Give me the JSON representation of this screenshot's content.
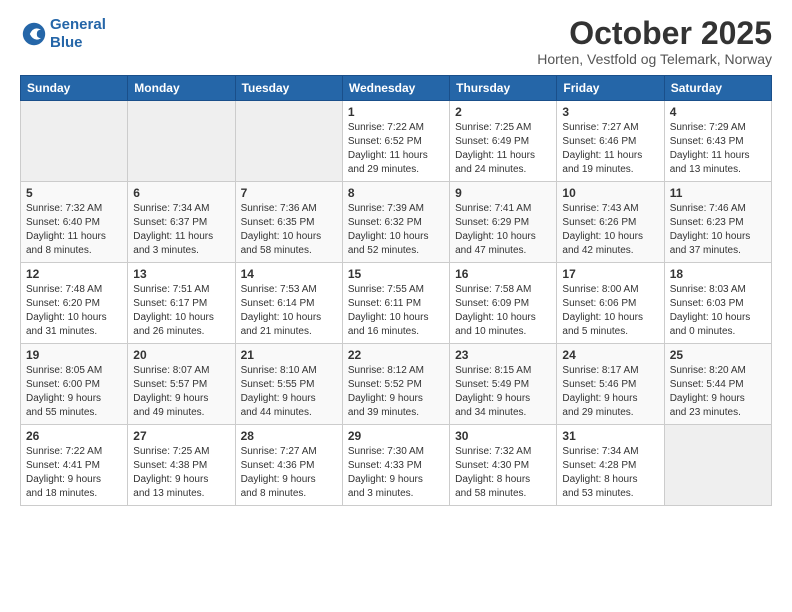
{
  "header": {
    "logo_line1": "General",
    "logo_line2": "Blue",
    "title": "October 2025",
    "subtitle": "Horten, Vestfold og Telemark, Norway"
  },
  "days_of_week": [
    "Sunday",
    "Monday",
    "Tuesday",
    "Wednesday",
    "Thursday",
    "Friday",
    "Saturday"
  ],
  "weeks": [
    [
      {
        "num": "",
        "info": ""
      },
      {
        "num": "",
        "info": ""
      },
      {
        "num": "",
        "info": ""
      },
      {
        "num": "1",
        "info": "Sunrise: 7:22 AM\nSunset: 6:52 PM\nDaylight: 11 hours\nand 29 minutes."
      },
      {
        "num": "2",
        "info": "Sunrise: 7:25 AM\nSunset: 6:49 PM\nDaylight: 11 hours\nand 24 minutes."
      },
      {
        "num": "3",
        "info": "Sunrise: 7:27 AM\nSunset: 6:46 PM\nDaylight: 11 hours\nand 19 minutes."
      },
      {
        "num": "4",
        "info": "Sunrise: 7:29 AM\nSunset: 6:43 PM\nDaylight: 11 hours\nand 13 minutes."
      }
    ],
    [
      {
        "num": "5",
        "info": "Sunrise: 7:32 AM\nSunset: 6:40 PM\nDaylight: 11 hours\nand 8 minutes."
      },
      {
        "num": "6",
        "info": "Sunrise: 7:34 AM\nSunset: 6:37 PM\nDaylight: 11 hours\nand 3 minutes."
      },
      {
        "num": "7",
        "info": "Sunrise: 7:36 AM\nSunset: 6:35 PM\nDaylight: 10 hours\nand 58 minutes."
      },
      {
        "num": "8",
        "info": "Sunrise: 7:39 AM\nSunset: 6:32 PM\nDaylight: 10 hours\nand 52 minutes."
      },
      {
        "num": "9",
        "info": "Sunrise: 7:41 AM\nSunset: 6:29 PM\nDaylight: 10 hours\nand 47 minutes."
      },
      {
        "num": "10",
        "info": "Sunrise: 7:43 AM\nSunset: 6:26 PM\nDaylight: 10 hours\nand 42 minutes."
      },
      {
        "num": "11",
        "info": "Sunrise: 7:46 AM\nSunset: 6:23 PM\nDaylight: 10 hours\nand 37 minutes."
      }
    ],
    [
      {
        "num": "12",
        "info": "Sunrise: 7:48 AM\nSunset: 6:20 PM\nDaylight: 10 hours\nand 31 minutes."
      },
      {
        "num": "13",
        "info": "Sunrise: 7:51 AM\nSunset: 6:17 PM\nDaylight: 10 hours\nand 26 minutes."
      },
      {
        "num": "14",
        "info": "Sunrise: 7:53 AM\nSunset: 6:14 PM\nDaylight: 10 hours\nand 21 minutes."
      },
      {
        "num": "15",
        "info": "Sunrise: 7:55 AM\nSunset: 6:11 PM\nDaylight: 10 hours\nand 16 minutes."
      },
      {
        "num": "16",
        "info": "Sunrise: 7:58 AM\nSunset: 6:09 PM\nDaylight: 10 hours\nand 10 minutes."
      },
      {
        "num": "17",
        "info": "Sunrise: 8:00 AM\nSunset: 6:06 PM\nDaylight: 10 hours\nand 5 minutes."
      },
      {
        "num": "18",
        "info": "Sunrise: 8:03 AM\nSunset: 6:03 PM\nDaylight: 10 hours\nand 0 minutes."
      }
    ],
    [
      {
        "num": "19",
        "info": "Sunrise: 8:05 AM\nSunset: 6:00 PM\nDaylight: 9 hours\nand 55 minutes."
      },
      {
        "num": "20",
        "info": "Sunrise: 8:07 AM\nSunset: 5:57 PM\nDaylight: 9 hours\nand 49 minutes."
      },
      {
        "num": "21",
        "info": "Sunrise: 8:10 AM\nSunset: 5:55 PM\nDaylight: 9 hours\nand 44 minutes."
      },
      {
        "num": "22",
        "info": "Sunrise: 8:12 AM\nSunset: 5:52 PM\nDaylight: 9 hours\nand 39 minutes."
      },
      {
        "num": "23",
        "info": "Sunrise: 8:15 AM\nSunset: 5:49 PM\nDaylight: 9 hours\nand 34 minutes."
      },
      {
        "num": "24",
        "info": "Sunrise: 8:17 AM\nSunset: 5:46 PM\nDaylight: 9 hours\nand 29 minutes."
      },
      {
        "num": "25",
        "info": "Sunrise: 8:20 AM\nSunset: 5:44 PM\nDaylight: 9 hours\nand 23 minutes."
      }
    ],
    [
      {
        "num": "26",
        "info": "Sunrise: 7:22 AM\nSunset: 4:41 PM\nDaylight: 9 hours\nand 18 minutes."
      },
      {
        "num": "27",
        "info": "Sunrise: 7:25 AM\nSunset: 4:38 PM\nDaylight: 9 hours\nand 13 minutes."
      },
      {
        "num": "28",
        "info": "Sunrise: 7:27 AM\nSunset: 4:36 PM\nDaylight: 9 hours\nand 8 minutes."
      },
      {
        "num": "29",
        "info": "Sunrise: 7:30 AM\nSunset: 4:33 PM\nDaylight: 9 hours\nand 3 minutes."
      },
      {
        "num": "30",
        "info": "Sunrise: 7:32 AM\nSunset: 4:30 PM\nDaylight: 8 hours\nand 58 minutes."
      },
      {
        "num": "31",
        "info": "Sunrise: 7:34 AM\nSunset: 4:28 PM\nDaylight: 8 hours\nand 53 minutes."
      },
      {
        "num": "",
        "info": ""
      }
    ]
  ]
}
